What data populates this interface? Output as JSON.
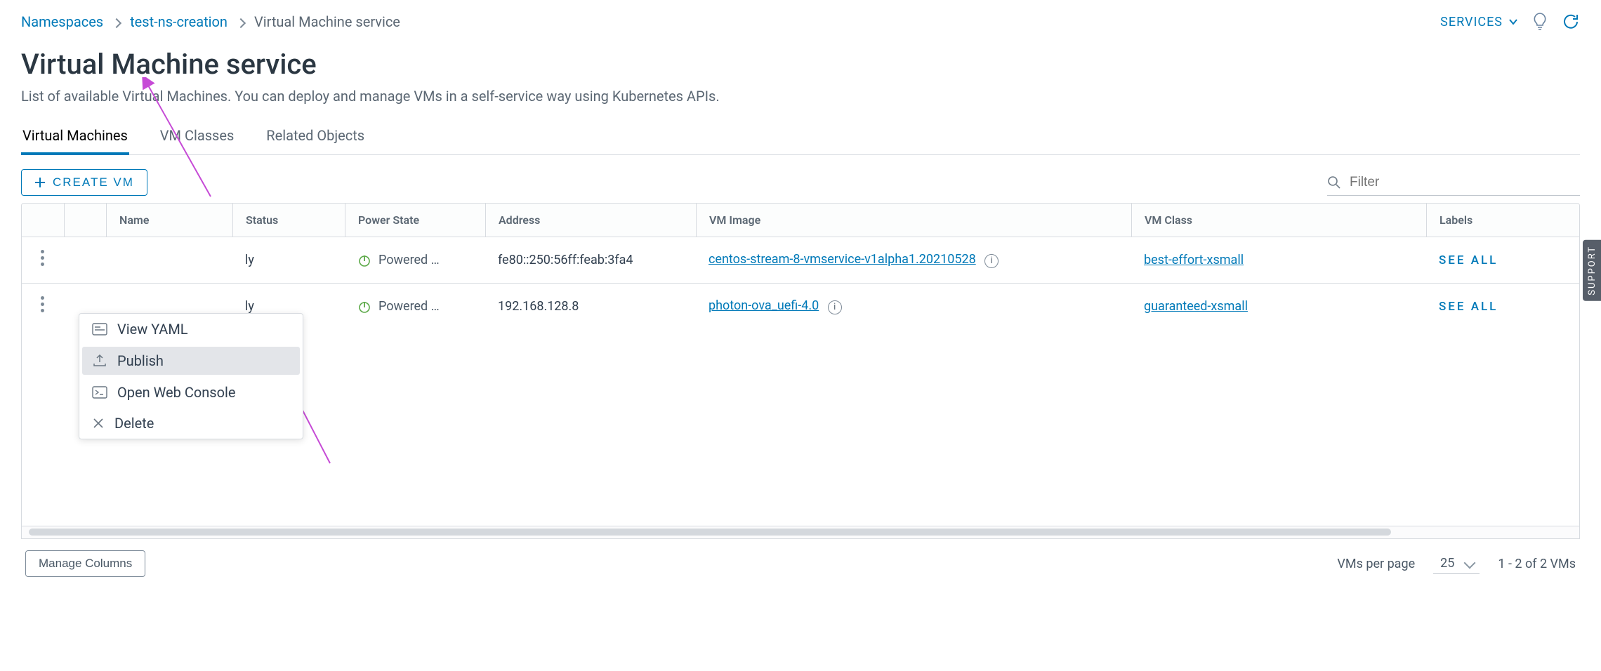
{
  "breadcrumb": {
    "root": "Namespaces",
    "ns": "test-ns-creation",
    "current": "Virtual Machine service"
  },
  "services_label": "SERVICES",
  "title": "Virtual Machine service",
  "subtitle": "List of available Virtual Machines. You can deploy and manage VMs in a self-service way using Kubernetes APIs.",
  "tabs": [
    {
      "label": "Virtual Machines",
      "active": true
    },
    {
      "label": "VM Classes",
      "active": false
    },
    {
      "label": "Related Objects",
      "active": false
    }
  ],
  "create_button": "CREATE VM",
  "filter_placeholder": "Filter",
  "columns": {
    "name": "Name",
    "status": "Status",
    "power": "Power State",
    "address": "Address",
    "image": "VM Image",
    "class": "VM Class",
    "labels": "Labels"
  },
  "see_all": "SEE ALL",
  "rows": [
    {
      "status_tail": "ly",
      "power": "Powered …",
      "address": "fe80::250:56ff:feab:3fa4",
      "image": "centos-stream-8-vmservice-v1alpha1.20210528",
      "class": "best-effort-xsmall"
    },
    {
      "status_tail": "ly",
      "power": "Powered …",
      "address": "192.168.128.8",
      "image": "photon-ova_uefi-4.0",
      "class": "guaranteed-xsmall"
    }
  ],
  "context_menu": {
    "view_yaml": "View YAML",
    "publish": "Publish",
    "open_console": "Open Web Console",
    "delete": "Delete"
  },
  "footer": {
    "manage_columns": "Manage Columns",
    "per_page_label": "VMs per page",
    "per_page_value": "25",
    "range": "1 - 2 of 2 VMs"
  },
  "support_tab": "SUPPORT"
}
